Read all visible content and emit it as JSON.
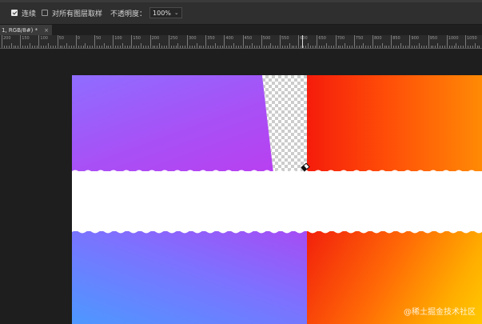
{
  "options_bar": {
    "contiguous_label": "连续",
    "contiguous_checked": true,
    "sample_all_layers_label": "对所有图层取样",
    "sample_all_layers_checked": false,
    "opacity_label": "不透明度：",
    "opacity_value": "100%"
  },
  "document_tab": {
    "title": "1, RGB/8#) *",
    "close_icon": "close-icon"
  },
  "ruler": {
    "labels": [
      "200",
      "150",
      "100",
      "50",
      "0",
      "50",
      "100",
      "150",
      "200",
      "250",
      "300",
      "350",
      "400",
      "450",
      "500",
      "550",
      "600",
      "650",
      "700",
      "750",
      "800",
      "850",
      "900",
      "950",
      "1000",
      "1050"
    ]
  },
  "canvas": {
    "colors": {
      "purple": "#a94ff6",
      "blue": "#4d98ff",
      "red": "#f51c0b",
      "orange": "#ff8a05",
      "yellow": "#ffc800",
      "white": "#ffffff"
    },
    "tool_cursor_icon": "eraser-icon"
  },
  "watermark": {
    "text": "@稀土掘金技术社区"
  }
}
